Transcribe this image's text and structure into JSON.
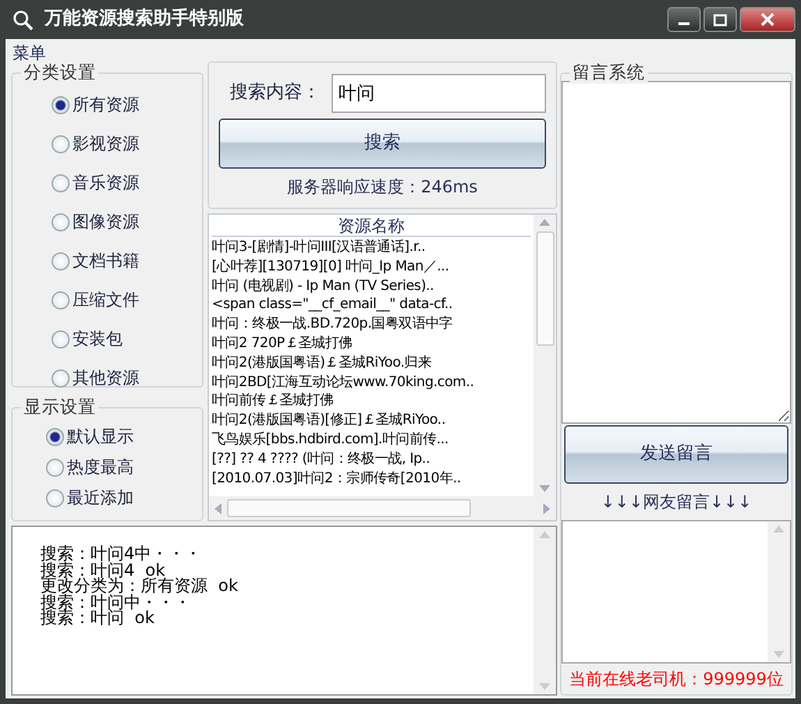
{
  "window": {
    "title": "万能资源搜索助手特别版"
  },
  "menu": [
    "菜单"
  ],
  "category_group": {
    "title": "分类设置",
    "options": [
      {
        "label": "所有资源",
        "selected": true
      },
      {
        "label": "影视资源",
        "selected": false
      },
      {
        "label": "音乐资源",
        "selected": false
      },
      {
        "label": "图像资源",
        "selected": false
      },
      {
        "label": "文档书籍",
        "selected": false
      },
      {
        "label": "压缩文件",
        "selected": false
      },
      {
        "label": "安装包",
        "selected": false
      },
      {
        "label": "其他资源",
        "selected": false
      }
    ]
  },
  "display_group": {
    "title": "显示设置",
    "options": [
      {
        "label": "默认显示",
        "selected": true
      },
      {
        "label": "热度最高",
        "selected": false
      },
      {
        "label": "最近添加",
        "selected": false
      }
    ]
  },
  "search": {
    "label": "搜索内容：",
    "value": "叶问",
    "button": "搜索",
    "speed": "服务器响应速度：246ms"
  },
  "results": {
    "column": "资源名称",
    "rows": [
      "叶问3-[剧情]-叶问III[汉语普通话].r..",
      "[心叶荐][130719][0] 叶问_Ip Man／...",
      "叶问 (电视剧) - Ip Man (TV Series)..",
      "<span class=\"__cf_email__\" data-cf..",
      "叶问：终极一战.BD.720p.国粤双语中字",
      "叶问2 720P￡圣城打佛",
      "叶问2(港版国粤语)￡圣城RiYoo.归来",
      "叶问2BD[江海互动论坛www.70king.com..",
      "叶问前传￡圣城打佛",
      "叶问2(港版国粤语)[修正]￡圣城RiYoo..",
      "飞鸟娱乐[bbs.hdbird.com].叶问前传...",
      "[??] ?? 4 ???? (叶问：终极一战, Ip..",
      "[2010.07.03]叶问2：宗师传奇[2010年.."
    ]
  },
  "log": [
    "搜索：叶问4中・・・",
    "搜索：叶问4  ok",
    "更改分类为：所有资源  ok",
    "搜索：叶问中・・・",
    "搜索：叶问  ok"
  ],
  "message_system": {
    "title": "留言系统",
    "send_button": "发送留言",
    "friends_label": "↓↓↓网友留言↓↓↓",
    "online": "当前在线老司机：999999位"
  }
}
